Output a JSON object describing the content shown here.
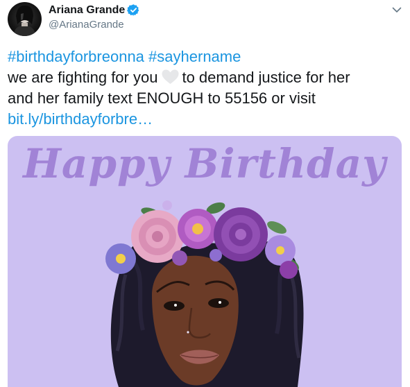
{
  "tweet": {
    "author": {
      "display_name": "Ariana Grande",
      "handle": "@ArianaGrande",
      "verified": true,
      "avatar_icon": "avatar-photo"
    },
    "menu_icon": "chevron-down-icon",
    "text": {
      "line1": {
        "hashtag1": "#birthdayforbreonna",
        "hashtag2": "#sayhername"
      },
      "line2": {
        "before": "we are fighting for you",
        "emoji": "white-heart-icon",
        "after": "to demand justice for her"
      },
      "line3": "and her family text ENOUGH to 55156 or visit",
      "link": "bit.ly/birthdayforbre…"
    },
    "media": {
      "title": "Happy Birthday",
      "background_color": "#ccc0f2"
    }
  },
  "colors": {
    "link": "#1b95e0",
    "verified": "#1da1f2",
    "secondary_text": "#657786",
    "primary_text": "#14171a"
  }
}
